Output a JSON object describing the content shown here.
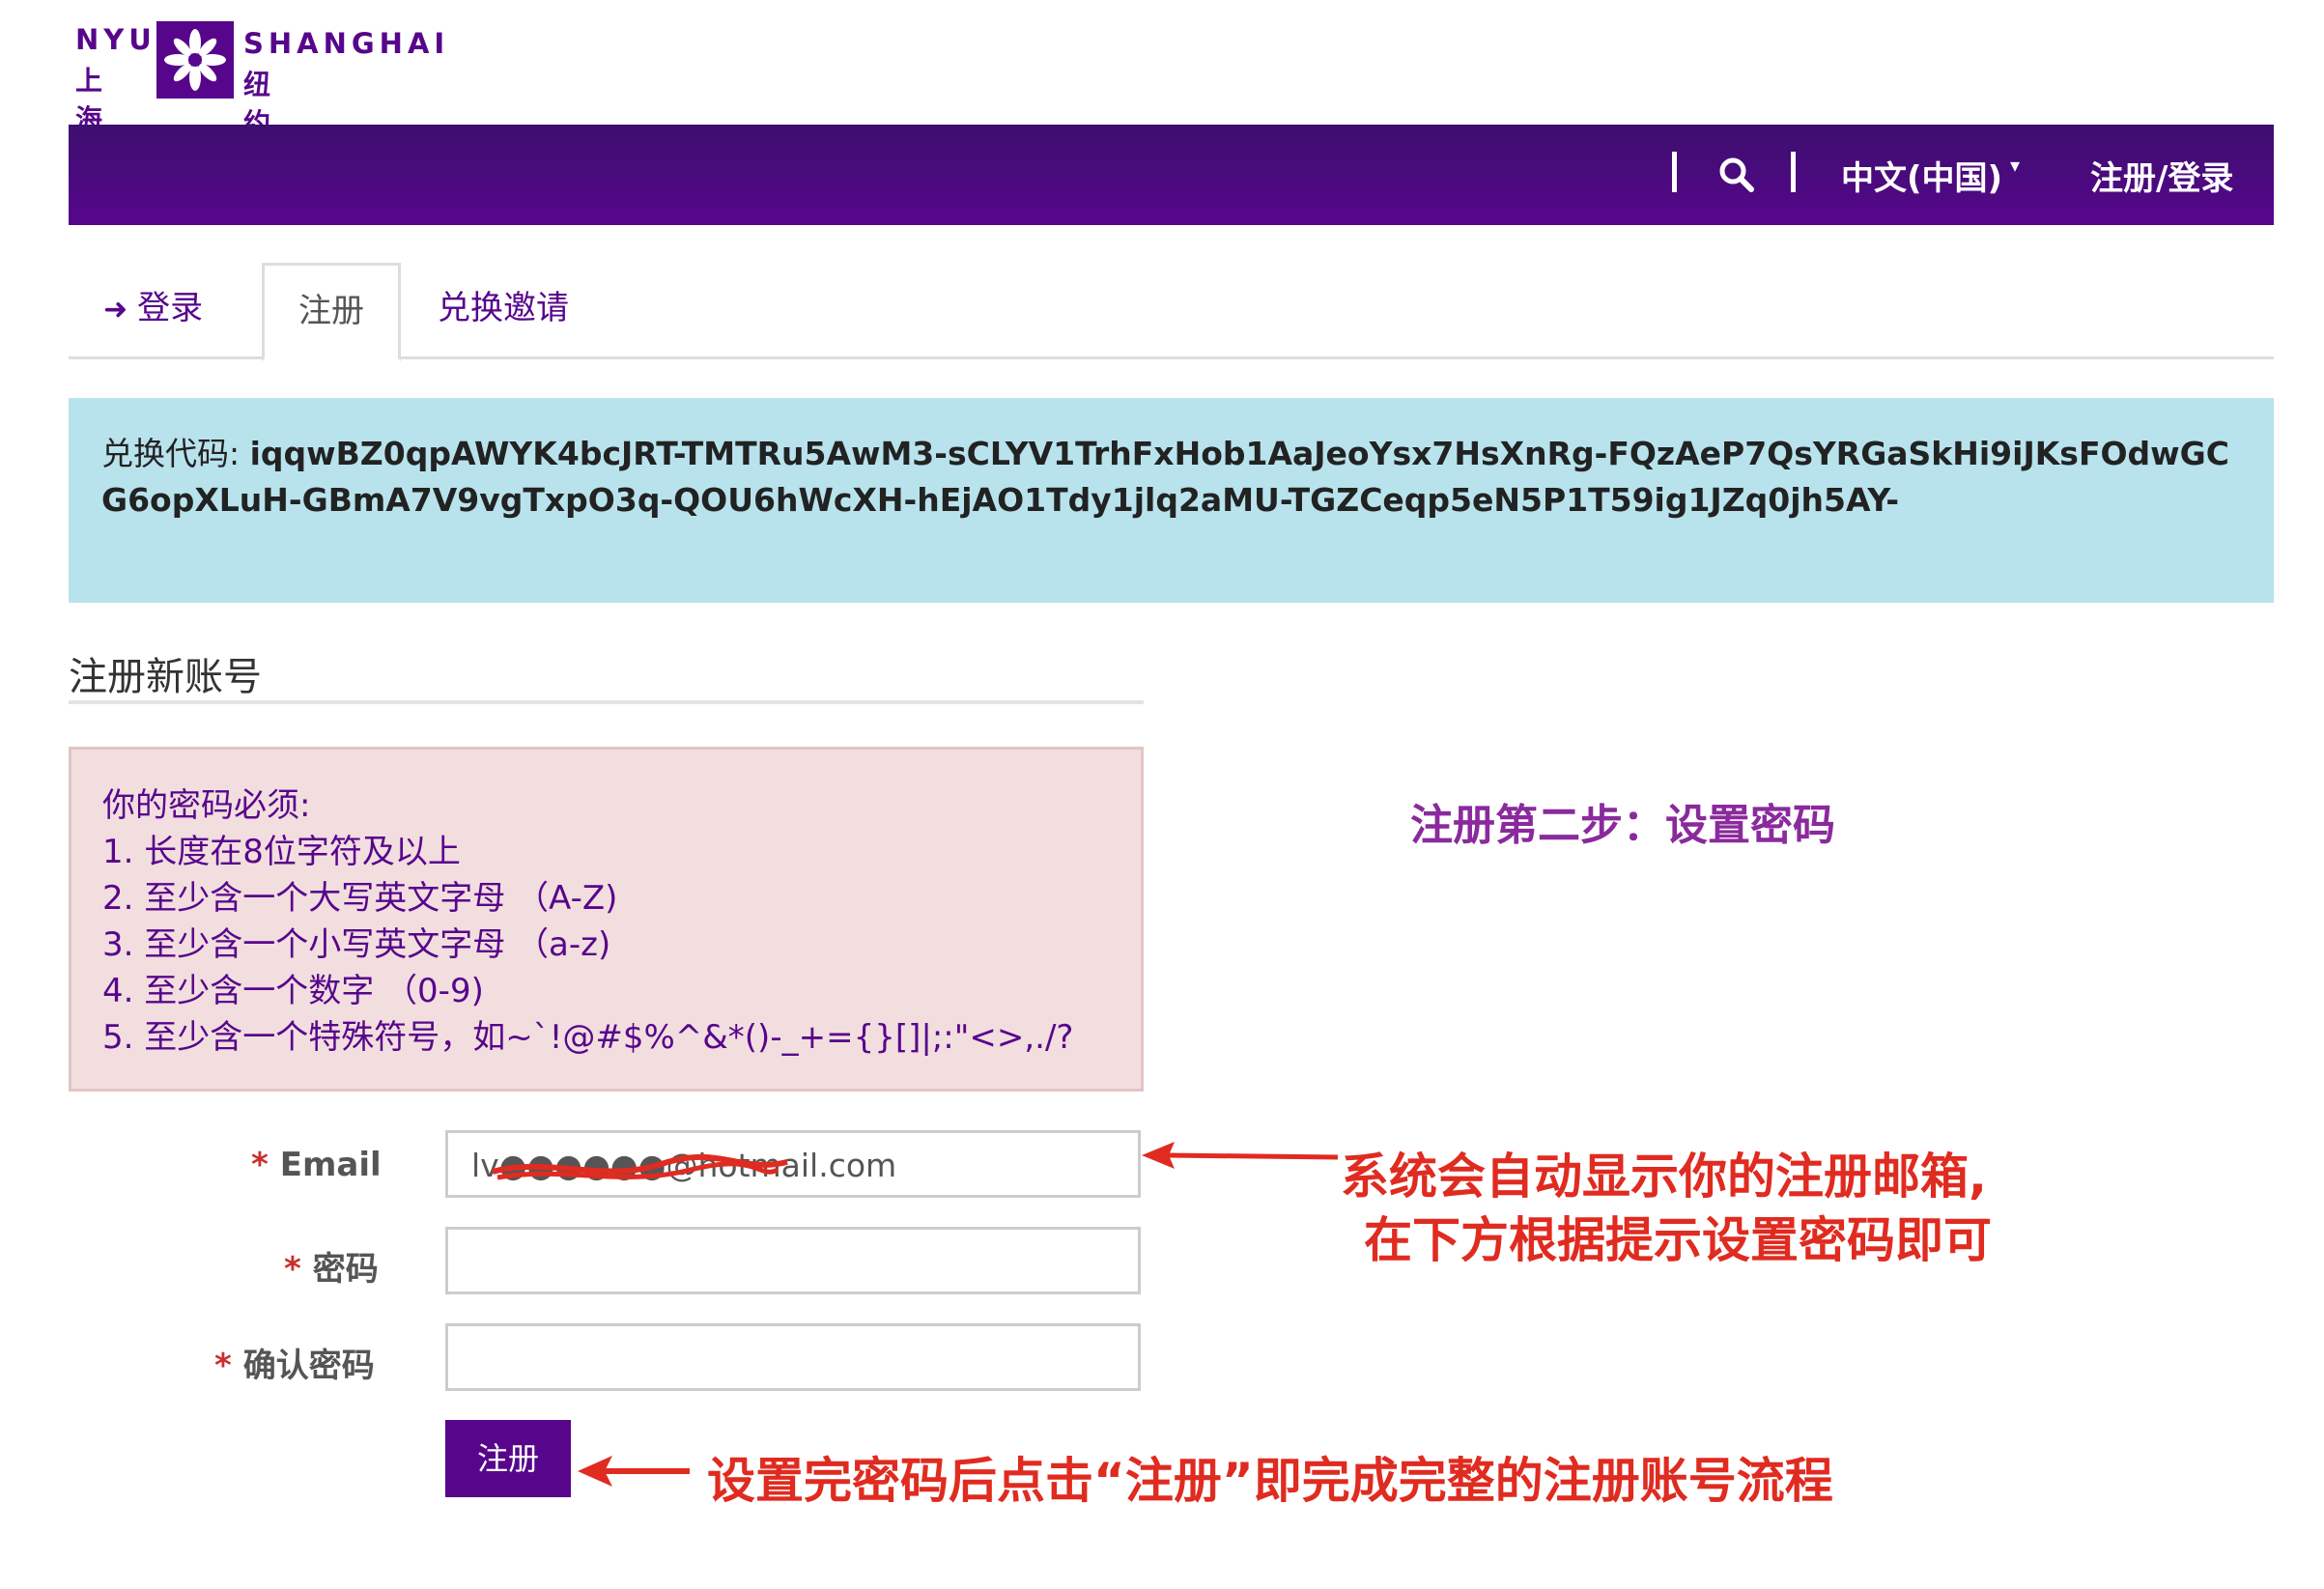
{
  "logo": {
    "nyu": "NYU",
    "shanghai_cn": "上海",
    "shanghai": "SHANGHAI",
    "nyu_cn": "纽约大学"
  },
  "navbar": {
    "search_icon": "search-icon",
    "language": "中文(中国)",
    "register_login": "注册/登录"
  },
  "tabs": [
    {
      "label": "登录",
      "icon": "sign-in-icon"
    },
    {
      "label": "注册"
    },
    {
      "label": "兑换邀请"
    }
  ],
  "redeem": {
    "label": "兑换代码: ",
    "code": "iqqwBZ0qpAWYK4bcJRT-TMTRu5AwM3-sCLYV1TrhFxHob1AaJeoYsx7HsXnRg-FQzAeP7QsYRGaSkHi9iJKsFOdwGCG6opXLuH-GBmA7V9vgTxpO3q-QOU6hWcXH-hEjAO1Tdy1jlq2aMU-TGZCeqp5eN5P1T59ig1JZq0jh5AY-"
  },
  "heading": "注册新账号",
  "rules": {
    "title": "你的密码必须:",
    "items": [
      "1. 长度在8位字符及以上",
      "2. 至少含一个大写英文字母 （A-Z)",
      "3. 至少含一个小写英文字母 （a-z)",
      "4. 至少含一个数字 （0-9)",
      "5. 至少含一个特殊符号，如~`!@#$%^&*()-_+={}[]|;:\"<>,./?"
    ]
  },
  "step_note": "注册第二步：设置密码",
  "form": {
    "email_label": "Email",
    "email_value": "lv●●●●●●@hotmail.com",
    "password_label": "密码",
    "confirm_label": "确认密码",
    "required_mark": "*",
    "submit_label": "注册"
  },
  "annotations": {
    "email_note_line1": "系统会自动显示你的注册邮箱,",
    "email_note_line2": "在下方根据提示设置密码即可",
    "submit_note": "设置完密码后点击“注册”即完成完整的注册账号流程"
  },
  "colors": {
    "brand": "#57068c",
    "info_bg": "#b8e3ed",
    "danger_bg": "#f2dede",
    "annotation_red": "#e02b20"
  }
}
